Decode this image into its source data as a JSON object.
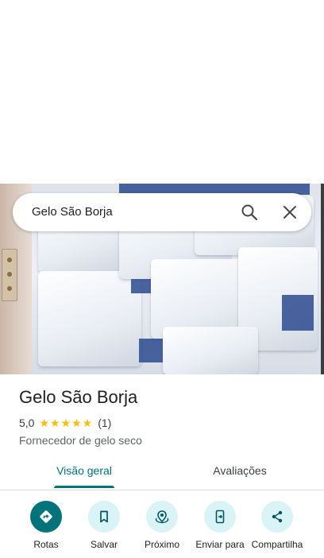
{
  "search": {
    "query": "Gelo São Borja"
  },
  "place": {
    "name": "Gelo São Borja",
    "rating": "5,0",
    "stars": "★★★★★",
    "review_count": "(1)",
    "category": "Fornecedor de gelo seco"
  },
  "tabs": [
    {
      "label": "Visão geral",
      "selected": true
    },
    {
      "label": "Avaliações",
      "selected": false
    }
  ],
  "actions": [
    {
      "label": "Rotas",
      "icon": "directions-icon"
    },
    {
      "label": "Salvar",
      "icon": "bookmark-icon"
    },
    {
      "label": "Próximo",
      "icon": "nearby-icon"
    },
    {
      "label": "Enviar para",
      "icon": "send-to-phone-icon"
    },
    {
      "label": "Compartilha",
      "icon": "share-icon"
    }
  ],
  "colors": {
    "accent": "#00737b",
    "action_bg": "#d9f3f6",
    "star": "#fbbc04"
  }
}
